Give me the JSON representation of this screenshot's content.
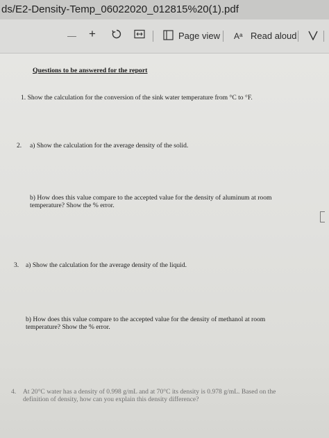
{
  "window": {
    "title": "ds/E2-Density-Temp_06022020_012815%20(1).pdf"
  },
  "toolbar": {
    "zoom_out": "—",
    "zoom_in": "+",
    "page_view_label": "Page view",
    "read_aloud_icon_text": "Aᵃ",
    "read_aloud_label": "Read aloud",
    "divider": "|"
  },
  "document": {
    "heading": "Questions to be answered for the report",
    "q1": "1.   Show the calculation for the conversion of the sink water temperature from °C to °F.",
    "q2_num": "2.",
    "q2a": "a) Show the calculation for the average density of the solid.",
    "q2b_line1": "b) How does this value compare to the accepted value for the density of aluminum at room",
    "q2b_line2": "temperature? Show the % error.",
    "q3_num": "3.",
    "q3a": "a) Show the calculation for the average density of the liquid.",
    "q3b_line1": "b) How does this value compare to the accepted value for the density of methanol at room",
    "q3b_line2": "temperature? Show the % error.",
    "q4_num": "4.",
    "q4_line1": "At 20°C water has a density of 0.998 g/mL and at 70°C its density is 0.978 g/mL. Based on the",
    "q4_line2": "definition of density, how can you explain this density difference?"
  }
}
